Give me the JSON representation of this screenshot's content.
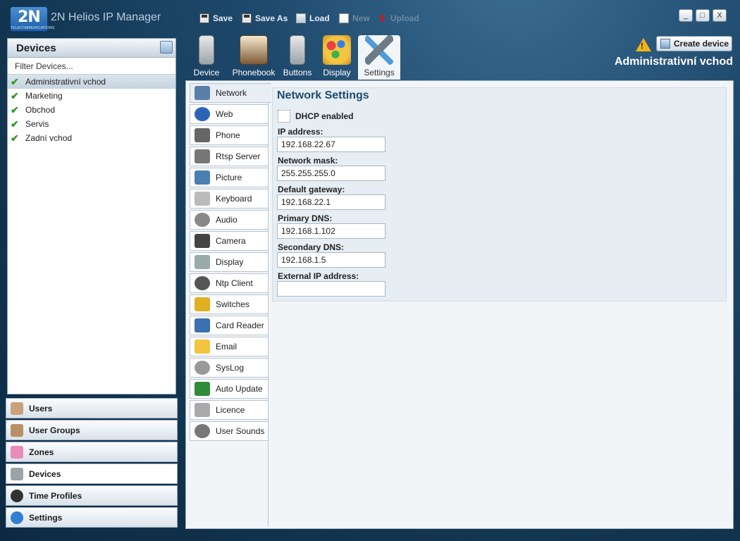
{
  "app": {
    "logo_text": "2N",
    "logo_sub": "TELECOMMUNICATIONS",
    "title": "2N Helios IP Manager"
  },
  "toolbar": {
    "save": "Save",
    "save_as": "Save As",
    "load": "Load",
    "new": "New",
    "upload": "Upload"
  },
  "window": {
    "minimize": "_",
    "maximize": "□",
    "close": "X"
  },
  "devices_panel": {
    "title": "Devices",
    "filter_placeholder": "Filter Devices...",
    "items": [
      {
        "label": "Administrativní vchod",
        "selected": true
      },
      {
        "label": "Marketing",
        "selected": false
      },
      {
        "label": "Obchod",
        "selected": false
      },
      {
        "label": "Servis",
        "selected": false
      },
      {
        "label": "Zadní vchod",
        "selected": false
      }
    ]
  },
  "left_nav": [
    {
      "label": "Users",
      "icon": "user-icon",
      "active": false
    },
    {
      "label": "User Groups",
      "icon": "user-group-icon",
      "active": false
    },
    {
      "label": "Zones",
      "icon": "zones-icon",
      "active": false
    },
    {
      "label": "Devices",
      "icon": "device-icon",
      "active": true
    },
    {
      "label": "Time Profiles",
      "icon": "clock-icon",
      "active": false
    },
    {
      "label": "Settings",
      "icon": "info-icon",
      "active": false
    }
  ],
  "device_tabs": [
    {
      "label": "Device",
      "icon": "intercom-icon"
    },
    {
      "label": "Phonebook",
      "icon": "phonebook-icon"
    },
    {
      "label": "Buttons",
      "icon": "buttons-icon"
    },
    {
      "label": "Display",
      "icon": "palette-icon"
    },
    {
      "label": "Settings",
      "icon": "tools-icon",
      "active": true
    }
  ],
  "header": {
    "create_device": "Create device",
    "current_device": "Administrativní vchod"
  },
  "settings_tabs": [
    {
      "label": "Network",
      "icon": "network-icon",
      "active": true
    },
    {
      "label": "Web",
      "icon": "globe-icon"
    },
    {
      "label": "Phone",
      "icon": "phone-icon"
    },
    {
      "label": "Rtsp Server",
      "icon": "server-icon"
    },
    {
      "label": "Picture",
      "icon": "picture-icon"
    },
    {
      "label": "Keyboard",
      "icon": "keyboard-icon"
    },
    {
      "label": "Audio",
      "icon": "speaker-icon"
    },
    {
      "label": "Camera",
      "icon": "camera-icon"
    },
    {
      "label": "Display",
      "icon": "display-icon"
    },
    {
      "label": "Ntp Client",
      "icon": "clock-icon"
    },
    {
      "label": "Switches",
      "icon": "switch-icon"
    },
    {
      "label": "Card Reader",
      "icon": "card-icon"
    },
    {
      "label": "Email",
      "icon": "email-icon"
    },
    {
      "label": "SysLog",
      "icon": "database-icon"
    },
    {
      "label": "Auto Update",
      "icon": "update-icon"
    },
    {
      "label": "Licence",
      "icon": "lock-icon"
    },
    {
      "label": "User Sounds",
      "icon": "sound-icon"
    }
  ],
  "network": {
    "title": "Network Settings",
    "dhcp_label": "DHCP enabled",
    "dhcp_checked": false,
    "fields": [
      {
        "label": "IP address:",
        "value": "192.168.22.67"
      },
      {
        "label": "Network mask:",
        "value": "255.255.255.0"
      },
      {
        "label": "Default gateway:",
        "value": "192.168.22.1"
      },
      {
        "label": "Primary DNS:",
        "value": "192.168.1.102"
      },
      {
        "label": "Secondary DNS:",
        "value": "192.168.1.5"
      },
      {
        "label": "External IP address:",
        "value": ""
      }
    ]
  }
}
